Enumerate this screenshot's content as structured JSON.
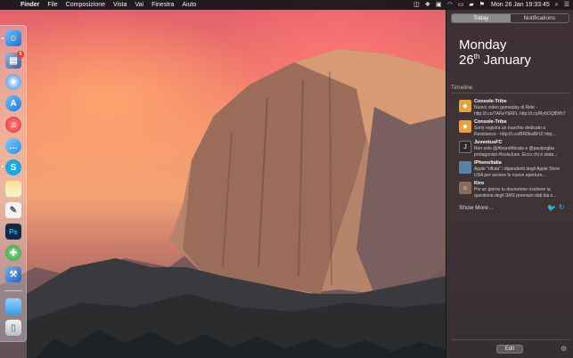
{
  "menubar": {
    "apple_icon": "apple-icon",
    "items": [
      "Finder",
      "File",
      "Composizione",
      "Vista",
      "Vai",
      "Finestra",
      "Aiuto"
    ],
    "clock": "Mon 26 Jan  19:33:45",
    "status_icons": [
      "screenshot-icon",
      "dropbox-icon",
      "notification-icon",
      "wifi-icon",
      "airplay-icon",
      "battery-icon",
      "flag-icon"
    ]
  },
  "dock": {
    "apps": [
      "finder-icon",
      "preview-icon",
      "safari-icon",
      "app-store-icon",
      "itunes-icon",
      "messages-icon",
      "skype-icon",
      "notes-icon",
      "textedit-icon",
      "photoshop-icon",
      "utility-icon",
      "xcode-icon",
      "folder-icon",
      "trash-icon"
    ],
    "badge": "5"
  },
  "notification_center": {
    "tabs": [
      "Today",
      "Notifications"
    ],
    "active_tab": "Today",
    "weekday": "Monday",
    "date_day": "26",
    "date_suffix": "th",
    "date_month": "January",
    "section": "Timeline",
    "items": [
      {
        "user": "Console-Tribe",
        "text": "Nuovo video gameplay di Ride - http://t.co/7AKeYbRFL http://t.co/Ry6OQ8Wh7",
        "avatar_color": "#e6a23c"
      },
      {
        "user": "Console-Tribe",
        "text": "Sony registra un marchio dedicato a Resistance - http://t.co/BR0kwBHJI http...",
        "avatar_color": "#e6a23c"
      },
      {
        "user": "JuventusFC",
        "text": "Non solo @AlvaroMorata e @paulpogba protagonisti #InsiaJuve. Ecco chi è stata...",
        "avatar_color": "#2b2b2b"
      },
      {
        "user": "iPhoneItalia",
        "text": "Apple \"rifiuta\" i dipendenti degli Apple Store USA per avviare le nuove aperture...",
        "avatar_color": "#5b7fa6"
      },
      {
        "user": "Kiro",
        "text": "Poi un giorno tu dovremmo risolvere la questione degli SMS premium dati dai s...",
        "avatar_color": "#8a6a5a"
      }
    ],
    "show_more": "Show More...",
    "edit_button": "Edit"
  }
}
